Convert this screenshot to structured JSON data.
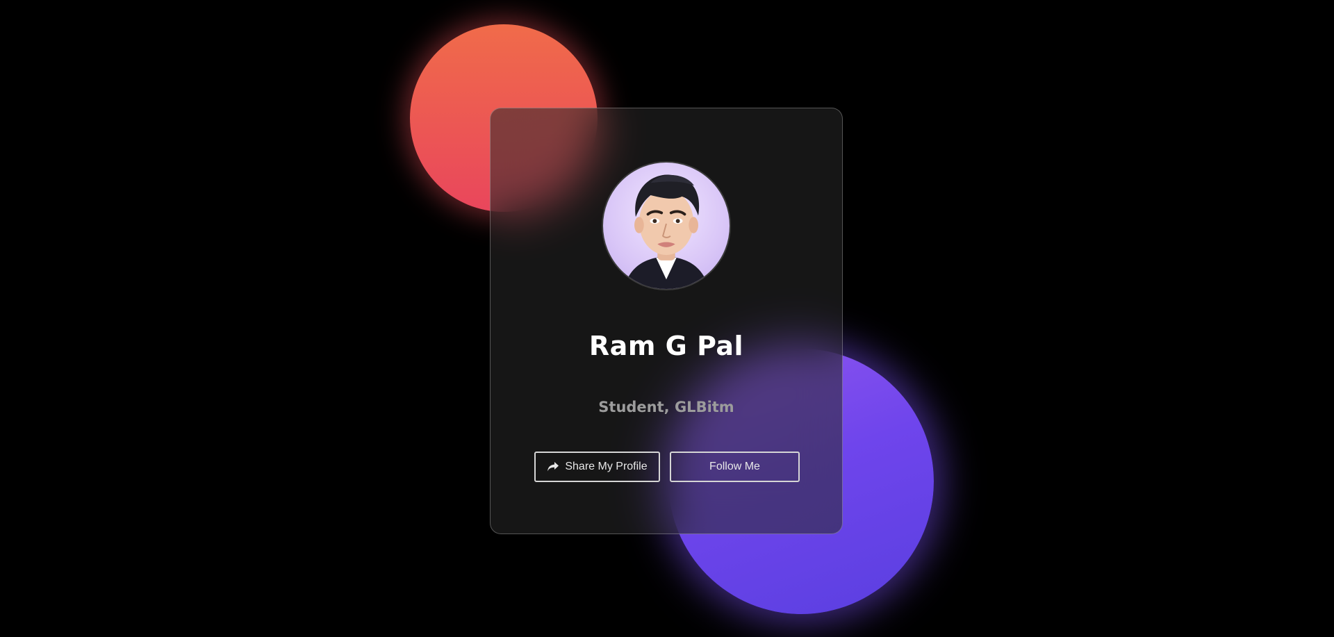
{
  "profile": {
    "name": "Ram G Pal",
    "role": "Student, GLBitm",
    "avatar_icon": "cartoon-avatar-portrait"
  },
  "actions": {
    "share_label": "Share My Profile",
    "share_icon": "share-arrow-icon",
    "follow_label": "Follow Me"
  },
  "colors": {
    "background": "#000000",
    "orange_blob": "#ee5a50",
    "purple_blob": "#6f45ec",
    "card_border": "#5a5a5a",
    "name_text": "#ffffff",
    "role_text": "#9c9c9c"
  }
}
